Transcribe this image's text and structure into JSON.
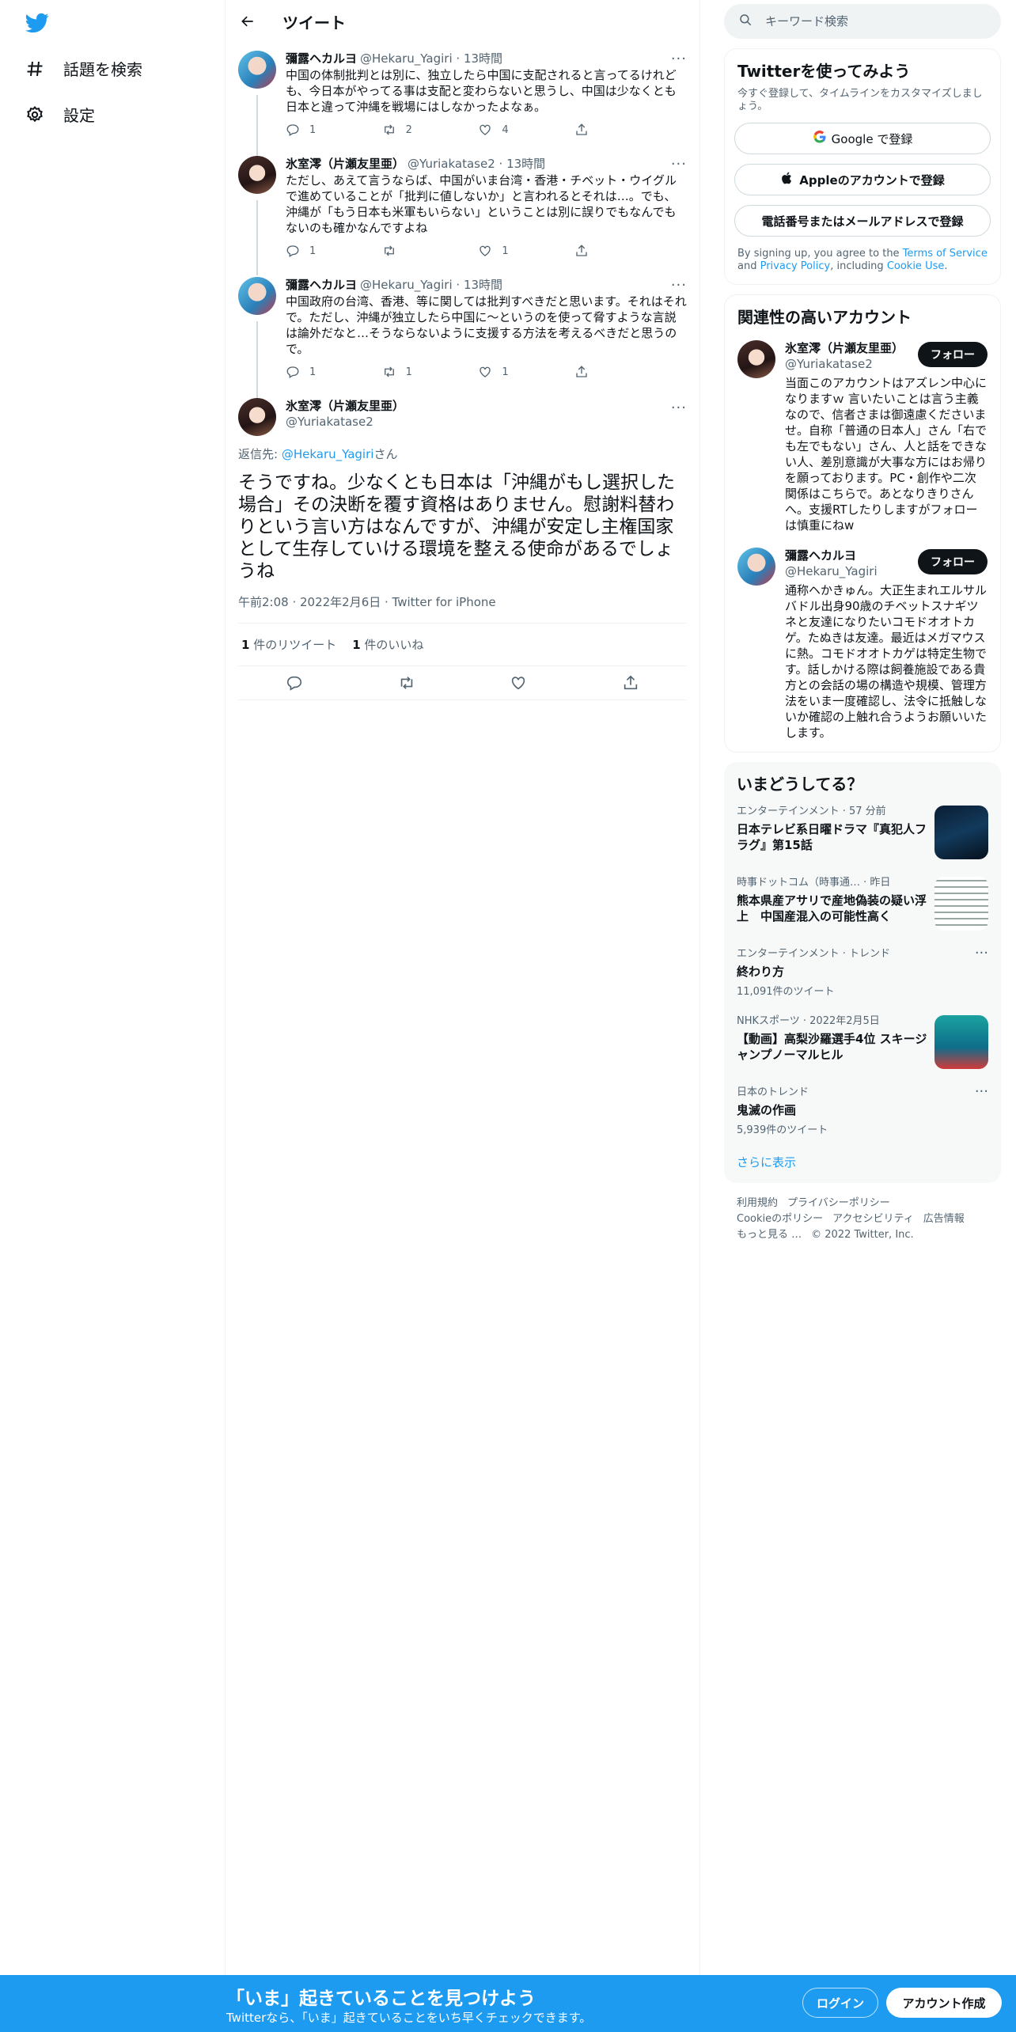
{
  "nav": {
    "explore_label": "話題を検索",
    "settings_label": "設定"
  },
  "header": {
    "title": "ツイート"
  },
  "thread": [
    {
      "name": "彌露ヘカルヨ",
      "handle": "@Hekaru_Yagiri",
      "time": "13時間",
      "text": "中国の体制批判とは別に、独立したら中国に支配されると言ってるけれども、今日本がやってる事は支配と変わらないと思うし、中国は少なくとも日本と違って沖縄を戦場にはしなかったよなぁ。",
      "replies": "1",
      "retweets": "2",
      "likes": "4"
    },
    {
      "name": "氷室澪（片瀬友里亜）",
      "handle": "@Yuriakatase2",
      "time": "13時間",
      "text": "ただし、あえて言うならば、中国がいま台湾・香港・チベット・ウイグルで進めていることが「批判に値しないか」と言われるとそれは…。でも、沖縄が「もう日本も米軍もいらない」ということは別に誤りでもなんでもないのも確かなんですよね",
      "replies": "1",
      "retweets": "",
      "likes": "1"
    },
    {
      "name": "彌露ヘカルヨ",
      "handle": "@Hekaru_Yagiri",
      "time": "13時間",
      "text": "中国政府の台湾、香港、等に関しては批判すべきだと思います。それはそれで。ただし、沖縄が独立したら中国に〜というのを使って脅すような言説は論外だなと…そうならないように支援する方法を考えるべきだと思うので。",
      "replies": "1",
      "retweets": "1",
      "likes": "1"
    }
  ],
  "focus": {
    "name": "氷室澪（片瀬友里亜）",
    "handle": "@Yuriakatase2",
    "reply_prefix": "返信先: ",
    "reply_handle": "@Hekaru_Yagiri",
    "reply_suffix": "さん",
    "text": "そうですね。少なくとも日本は「沖縄がもし選択した場合」その決断を覆す資格はありません。慰謝料替わりという言い方はなんですが、沖縄が安定し主権国家として生存していける環境を整える使命があるでしょうね",
    "meta": "午前2:08 · 2022年2月6日 · Twitter for iPhone",
    "rt_count": "1",
    "rt_label": " 件のリツイート",
    "like_count": "1",
    "like_label": " 件のいいね"
  },
  "search": {
    "placeholder": "キーワード検索"
  },
  "signup": {
    "title": "Twitterを使ってみよう",
    "sub": "今すぐ登録して、タイムラインをカスタマイズしましょう。",
    "google": "Google で登録",
    "apple": "Appleのアカウントで登録",
    "phone": "電話番号またはメールアドレスで登録",
    "terms_pre": "By signing up, you agree to the ",
    "terms_link": "Terms of Service",
    "terms_and": " and ",
    "privacy_link": "Privacy Policy",
    "terms_inc": ", including ",
    "cookie_link": "Cookie Use",
    "terms_end": "."
  },
  "relevant": {
    "title": "関連性の高いアカウント",
    "follow_label": "フォロー",
    "accounts": [
      {
        "name": "氷室澪（片瀬友里亜）",
        "handle": "@Yuriakatase2",
        "bio": "当面このアカウントはアズレン中心になりますｗ 言いたいことは言う主義なので、信者さまは御遠慮くださいませ。自称「普通の日本人」さん「右でも左でもない」さん、人と話をできない人、差別意識が大事な方にはお帰りを願っております。PC・創作や二次関係はこちらで。あとなりきりさんへ。支援RTしたりしますがフォローは慎重にねw"
      },
      {
        "name": "彌露ヘカルヨ",
        "handle": "@Hekaru_Yagiri",
        "bio": "通称ヘかきゅん。大正生まれエルサルバドル出身90歳のチベットスナギツネと友達になりたいコモドオオトカゲ。たぬきは友達。最近はメガマウスに熱。コモドオオトカゲは特定生物です。話しかける際は飼養施設である貴方との会話の場の構造や規模、管理方法をいま一度確認し、法令に抵触しないか確認の上触れ合うようお願いいたします。"
      }
    ]
  },
  "trends": {
    "title": "いまどうしてる？",
    "items": [
      {
        "meta": "エンターテインメント · 57 分前",
        "title": "日本テレビ系日曜ドラマ『真犯人フラグ』第15話",
        "count": ""
      },
      {
        "meta": "時事ドットコム（時事通… · 昨日",
        "title": "熊本県産アサリで産地偽装の疑い浮上　中国産混入の可能性高く",
        "count": ""
      },
      {
        "meta": "エンターテインメント · トレンド",
        "title": "終わり方",
        "count": "11,091件のツイート"
      },
      {
        "meta": "NHKスポーツ · 2022年2月5日",
        "title": "【動画】高梨沙羅選手4位 スキージャンプノーマルヒル",
        "count": ""
      },
      {
        "meta": "日本のトレンド",
        "title": "鬼滅の作画",
        "count": "5,939件のツイート"
      }
    ],
    "show_more": "さらに表示"
  },
  "footer": {
    "links": [
      "利用規約",
      "プライバシーポリシー",
      "Cookieのポリシー",
      "アクセシビリティ",
      "広告情報",
      "もっと見る …",
      "© 2022 Twitter, Inc."
    ]
  },
  "bottom": {
    "title": "「いま」起きていることを見つけよう",
    "sub": "Twitterなら、「いま」起きていることをいち早くチェックできます。",
    "login": "ログイン",
    "signup": "アカウント作成"
  },
  "colors": {
    "accent": "#1d9bf0",
    "text": "#0f1419",
    "muted": "#536471"
  }
}
